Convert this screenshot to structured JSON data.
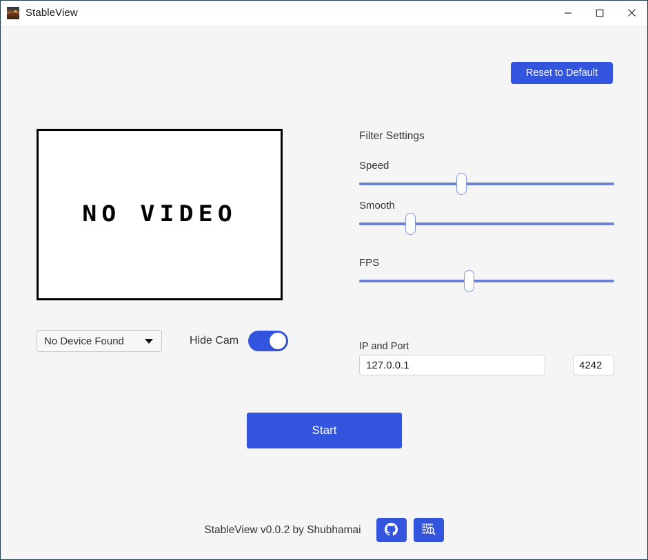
{
  "window": {
    "title": "StableView",
    "app_icon": "sunset-photo-icon",
    "controls": [
      {
        "name": "minimize",
        "glyph": "minimize-icon"
      },
      {
        "name": "maximize",
        "glyph": "maximize-icon"
      },
      {
        "name": "close",
        "glyph": "close-icon"
      }
    ]
  },
  "colors": {
    "accent": "#3355dd",
    "slider_track": "#6b7fd4",
    "slider_handle_border": "#8193d8",
    "background": "#f5f5f5",
    "window_border": "#1f3d4d",
    "titlebar": "#ffffff"
  },
  "toolbar": {
    "reset_label": "Reset to Default"
  },
  "preview": {
    "placeholder_text": "NO VIDEO"
  },
  "device": {
    "selected": "No Device Found",
    "caret_icon": "chevron-down-icon"
  },
  "hide_cam": {
    "label": "Hide Cam",
    "enabled": "on"
  },
  "filters": {
    "title": "Filter Settings",
    "sliders": [
      {
        "label": "Speed",
        "position_pct": 40
      },
      {
        "label": "Smooth",
        "position_pct": 20
      },
      {
        "label": "FPS",
        "position_pct": 43
      }
    ]
  },
  "network": {
    "label": "IP and Port",
    "ip_value": "127.0.0.1",
    "ip_placeholder": "127.0.0.1",
    "port_value": "4242",
    "port_placeholder": "4242"
  },
  "actions": {
    "start_label": "Start"
  },
  "footer": {
    "credit": "StableView v0.0.2 by Shubhamai",
    "buttons": [
      {
        "name": "github",
        "icon": "github-icon"
      },
      {
        "name": "source-code",
        "icon": "binary-code-search-icon"
      }
    ]
  }
}
